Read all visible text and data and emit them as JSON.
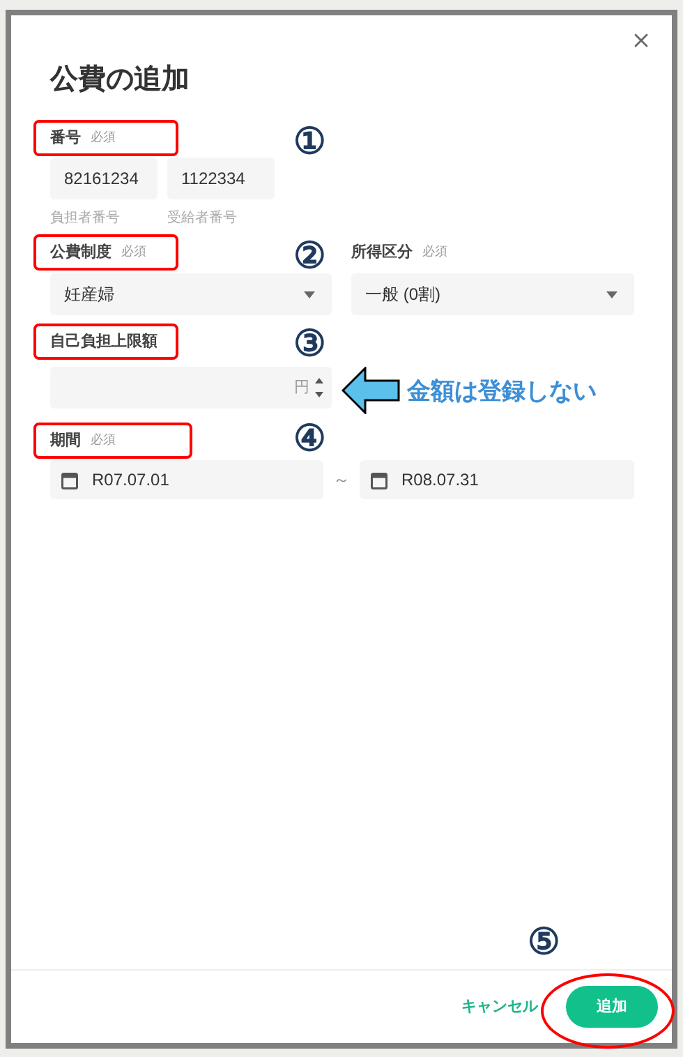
{
  "dialog": {
    "title": "公費の追加"
  },
  "number": {
    "label": "番号",
    "required": "必須",
    "inputs": [
      {
        "value": "82161234",
        "helper": "負担者番号"
      },
      {
        "value": "1122334",
        "helper": "受給者番号"
      }
    ]
  },
  "system": {
    "label": "公費制度",
    "required": "必須",
    "value": "妊産婦"
  },
  "income": {
    "label": "所得区分",
    "required": "必須",
    "value": "一般 (0割)"
  },
  "limit": {
    "label": "自己負担上限額",
    "unit": "円"
  },
  "period": {
    "label": "期間",
    "required": "必須",
    "from": "R07.07.01",
    "separator": "～",
    "to": "R08.07.31"
  },
  "footer": {
    "cancel": "キャンセル",
    "submit": "追加"
  },
  "annotations": {
    "markers": [
      "①",
      "②",
      "③",
      "④",
      "⑤"
    ],
    "note": "金額は登録しない"
  }
}
